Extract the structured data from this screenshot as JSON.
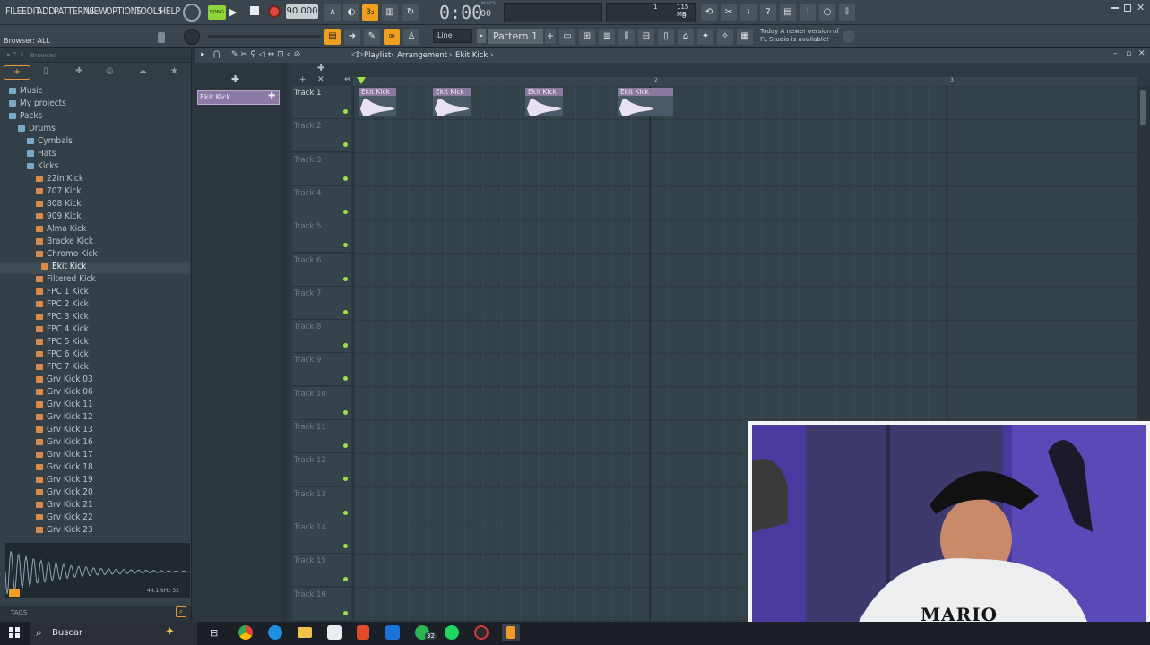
{
  "menu": [
    "FILE",
    "EDIT",
    "ADD",
    "PATTERNS",
    "VIEW",
    "OPTIONS",
    "TOOLS",
    "HELP"
  ],
  "transport": {
    "song_label": "SONG",
    "tempo": "90.000",
    "time": "0:00",
    "time_sub": "00",
    "time_unit": "M:S:CS",
    "memory": "115 MB",
    "cpu_top": "1",
    "cpu_bottom": "0"
  },
  "toolbar2": {
    "snap": "Line",
    "pattern": "Pattern 1",
    "news_line1": "Today  A newer version of",
    "news_line2": "FL Studio is available!"
  },
  "hint": "Browser: ALL",
  "browser": {
    "title": "Browser",
    "items": [
      {
        "label": "Music",
        "type": "folder",
        "indent": 0
      },
      {
        "label": "My projects",
        "type": "folder",
        "indent": 0
      },
      {
        "label": "Packs",
        "type": "folder",
        "indent": 0
      },
      {
        "label": "Drums",
        "type": "folder",
        "indent": 1
      },
      {
        "label": "Cymbals",
        "type": "folder",
        "indent": 2
      },
      {
        "label": "Hats",
        "type": "folder",
        "indent": 2
      },
      {
        "label": "Kicks",
        "type": "folder",
        "indent": 2
      },
      {
        "label": "22in Kick",
        "type": "wav",
        "indent": 3
      },
      {
        "label": "707 Kick",
        "type": "wav",
        "indent": 3
      },
      {
        "label": "808 Kick",
        "type": "wav",
        "indent": 3
      },
      {
        "label": "909 Kick",
        "type": "wav",
        "indent": 3
      },
      {
        "label": "Alma Kick",
        "type": "wav",
        "indent": 3
      },
      {
        "label": "Bracke Kick",
        "type": "wav",
        "indent": 3
      },
      {
        "label": "Chromo Kick",
        "type": "wav",
        "indent": 3
      },
      {
        "label": "Ekit Kick",
        "type": "wav",
        "indent": 4,
        "selected": true
      },
      {
        "label": "Filtered Kick",
        "type": "wav",
        "indent": 3
      },
      {
        "label": "FPC 1 Kick",
        "type": "wav",
        "indent": 3
      },
      {
        "label": "FPC 2 Kick",
        "type": "wav",
        "indent": 3
      },
      {
        "label": "FPC 3 Kick",
        "type": "wav",
        "indent": 3
      },
      {
        "label": "FPC 4 Kick",
        "type": "wav",
        "indent": 3
      },
      {
        "label": "FPC 5 Kick",
        "type": "wav",
        "indent": 3
      },
      {
        "label": "FPC 6 Kick",
        "type": "wav",
        "indent": 3
      },
      {
        "label": "FPC 7 Kick",
        "type": "wav",
        "indent": 3
      },
      {
        "label": "Grv Kick 03",
        "type": "wav",
        "indent": 3
      },
      {
        "label": "Grv Kick 06",
        "type": "wav",
        "indent": 3
      },
      {
        "label": "Grv Kick 11",
        "type": "wav",
        "indent": 3
      },
      {
        "label": "Grv Kick 12",
        "type": "wav",
        "indent": 3
      },
      {
        "label": "Grv Kick 13",
        "type": "wav",
        "indent": 3
      },
      {
        "label": "Grv Kick 16",
        "type": "wav",
        "indent": 3
      },
      {
        "label": "Grv Kick 17",
        "type": "wav",
        "indent": 3
      },
      {
        "label": "Grv Kick 18",
        "type": "wav",
        "indent": 3
      },
      {
        "label": "Grv Kick 19",
        "type": "wav",
        "indent": 3
      },
      {
        "label": "Grv Kick 20",
        "type": "wav",
        "indent": 3
      },
      {
        "label": "Grv Kick 21",
        "type": "wav",
        "indent": 3
      },
      {
        "label": "Grv Kick 22",
        "type": "wav",
        "indent": 3
      },
      {
        "label": "Grv Kick 23",
        "type": "wav",
        "indent": 3
      }
    ],
    "sample_info": "44.1 kHz 32",
    "tags": "TAGS"
  },
  "playlist": {
    "breadcrumb": [
      "Playlist",
      "Arrangement",
      "Ekit Kick"
    ],
    "picker_item": "Ekit Kick",
    "bar_markers": [
      "2",
      "3"
    ],
    "tracks": [
      "Track 1",
      "Track 2",
      "Track 3",
      "Track 4",
      "Track 5",
      "Track 6",
      "Track 7",
      "Track 8",
      "Track 9",
      "Track 10",
      "Track 11",
      "Track 12",
      "Track 13",
      "Track 14",
      "Track 15",
      "Track 16"
    ],
    "clip_label": "Ekit Kick"
  },
  "webcam": {
    "shirt_text": "MARIO"
  },
  "taskbar": {
    "search_placeholder": "Buscar",
    "badge": "32"
  }
}
